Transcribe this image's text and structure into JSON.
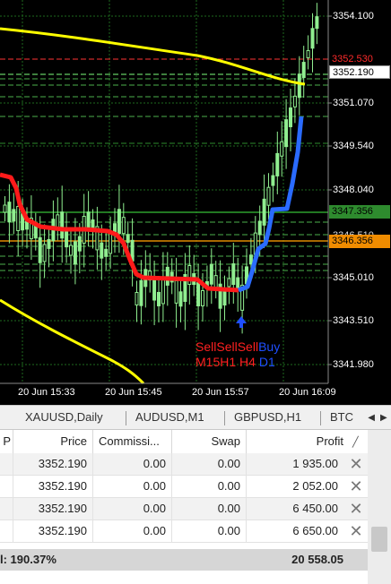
{
  "chart": {
    "price_ticks": [
      "3354.100",
      "3351.070",
      "3349.540",
      "3348.040",
      "3345.010",
      "3343.510",
      "3341.980"
    ],
    "price_tags": {
      "ask": "3352.530",
      "bid": "3352.190",
      "level_green": "3347.356",
      "level_orange": "3346.356",
      "level_cut": "3346.510"
    },
    "time_ticks": [
      "20 Jun 15:33",
      "20 Jun 15:45",
      "20 Jun 15:57",
      "20 Jun 16:09"
    ],
    "signals": {
      "row1": [
        {
          "text": "Sell",
          "color": "#ff2020"
        },
        {
          "text": "Sell",
          "color": "#ff2020"
        },
        {
          "text": "Sell",
          "color": "#ff2020"
        },
        {
          "text": "Buy",
          "color": "#1f4fff"
        }
      ],
      "row2": [
        {
          "text": "M15",
          "color": "#ff2020"
        },
        {
          "text": "H1",
          "color": "#ff2020"
        },
        {
          "text": "H4",
          "color": "#ff2020"
        },
        {
          "text": "D1",
          "color": "#1f4fff"
        }
      ]
    },
    "colors": {
      "background": "#000000",
      "candles": "#90ee90",
      "ma_line": "#ffff00",
      "sell_line": "#ff1a1a",
      "buy_line": "#2a6bff",
      "grid": "#1e6a1e"
    }
  },
  "tabs": [
    "XAUUSD,Daily",
    "AUDUSD,M1",
    "GBPUSD,H1",
    "BTC"
  ],
  "table": {
    "columns": [
      "P",
      "Price",
      "Commissi...",
      "Swap",
      "Profit"
    ],
    "rows": [
      {
        "price": "3352.190",
        "commission": "0.00",
        "swap": "0.00",
        "profit": "1 935.00"
      },
      {
        "price": "3352.190",
        "commission": "0.00",
        "swap": "0.00",
        "profit": "2 052.00"
      },
      {
        "price": "3352.190",
        "commission": "0.00",
        "swap": "0.00",
        "profit": "6 450.00"
      },
      {
        "price": "3352.190",
        "commission": "0.00",
        "swap": "0.00",
        "profit": "6 650.00"
      }
    ],
    "total_label": "l: 190.37%",
    "total_profit": "20 558.05"
  },
  "icons": [
    "buy-arrow-icon",
    "close-icon",
    "sort-icon",
    "tab-left-arrow-icon",
    "tab-right-arrow-icon"
  ]
}
